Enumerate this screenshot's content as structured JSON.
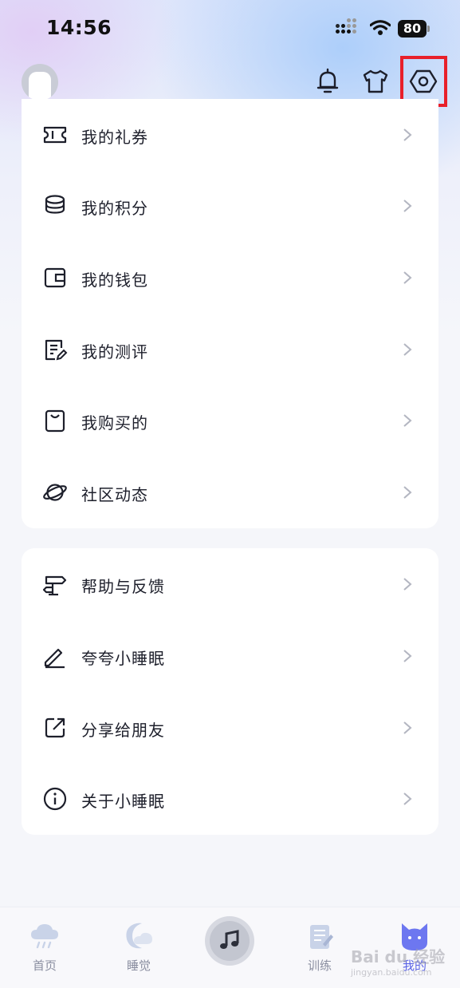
{
  "status_bar": {
    "time": "14:56",
    "battery": "80"
  },
  "header": {
    "icons": [
      "avatar",
      "bell-icon",
      "shirt-icon",
      "settings-icon"
    ],
    "highlight_color": "#e8202a"
  },
  "menu_group_1": [
    {
      "icon": "ticket-icon",
      "label": "我的礼券"
    },
    {
      "icon": "coins-icon",
      "label": "我的积分"
    },
    {
      "icon": "wallet-icon",
      "label": "我的钱包"
    },
    {
      "icon": "note-edit-icon",
      "label": "我的测评"
    },
    {
      "icon": "shopping-bag-icon",
      "label": "我购买的"
    },
    {
      "icon": "planet-icon",
      "label": "社区动态"
    }
  ],
  "menu_group_2": [
    {
      "icon": "signpost-icon",
      "label": "帮助与反馈"
    },
    {
      "icon": "pen-icon",
      "label": "夸夸小睡眠"
    },
    {
      "icon": "share-icon",
      "label": "分享给朋友"
    },
    {
      "icon": "info-icon",
      "label": "关于小睡眠"
    }
  ],
  "tabbar": {
    "tabs": [
      {
        "icon": "cloud-rain-icon",
        "label": "首页"
      },
      {
        "icon": "moon-icon",
        "label": "睡觉"
      },
      {
        "icon": "music-note-icon",
        "label": ""
      },
      {
        "icon": "notepad-icon",
        "label": "训练"
      },
      {
        "icon": "cat-avatar-icon",
        "label": "我的"
      }
    ],
    "active_index": 4,
    "active_color": "#5a63e6"
  },
  "watermark": {
    "text": "Bai du 经验",
    "subtext": "jingyan.baidu.com"
  }
}
